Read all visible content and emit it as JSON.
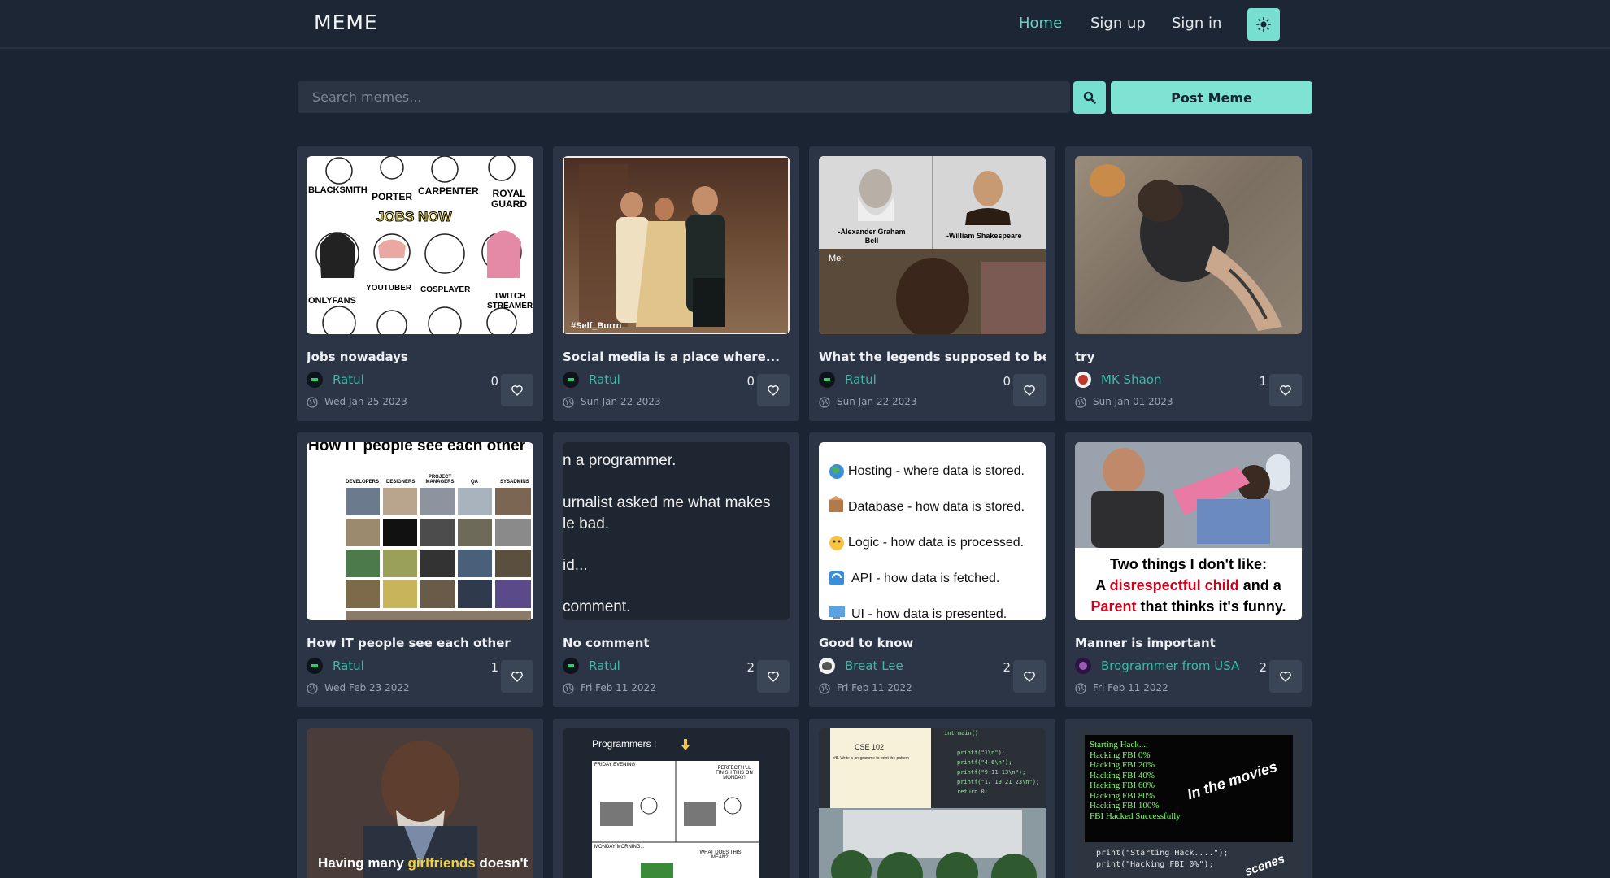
{
  "nav": {
    "brand": "MEME",
    "links": [
      "Home",
      "Sign up",
      "Sign in"
    ]
  },
  "search": {
    "placeholder": "Search memes...",
    "post_label": "Post Meme"
  },
  "colors": {
    "accent": "#76dfd0",
    "author": "#3fb8a8",
    "background": "#1b2433",
    "card": "#2b3545"
  },
  "cards": [
    {
      "title": "Jobs nowadays",
      "author": "Ratul",
      "likes": "0",
      "date": "Wed Jan 25 2023",
      "thumb_text": [
        "BLACKSMITH",
        "PORTER",
        "CARPENTER",
        "ROYAL GUARD",
        "JOBS NOW",
        "YOUTUBER",
        "COSPLAYER",
        "TWITCH STREAMER",
        "ONLYFANS"
      ]
    },
    {
      "title": "Social media is a place where...",
      "author": "Ratul",
      "likes": "0",
      "date": "Sun Jan 22 2023",
      "thumb_text": [
        "#Self_Burrn"
      ]
    },
    {
      "title": "What the legends supposed to be...",
      "author": "Ratul",
      "likes": "0",
      "date": "Sun Jan 22 2023",
      "thumb_text": [
        "-Alexander Graham Bell",
        "-William Shakespeare",
        "Me:"
      ]
    },
    {
      "title": "try",
      "author": "MK Shaon",
      "likes": "1",
      "date": "Sun Jan 01 2023",
      "thumb_text": []
    },
    {
      "title": "How IT people see each other",
      "author": "Ratul",
      "likes": "1",
      "date": "Wed Feb 23 2022",
      "thumb_text": [
        "How IT people see each other",
        "DEVELOPERS",
        "DESIGNERS",
        "PROJECT MANAGERS",
        "QA",
        "SYSADMINS"
      ]
    },
    {
      "title": "No comment",
      "author": "Ratul",
      "likes": "2",
      "date": "Fri Feb 11 2022",
      "thumb_text": [
        "n a programmer.",
        "urnalist asked me what makes",
        "le bad.",
        "id...",
        "comment."
      ]
    },
    {
      "title": "Good to know",
      "author": "Breat Lee",
      "likes": "2",
      "date": "Fri Feb 11 2022",
      "thumb_text": [
        "Hosting - where data is stored.",
        "Database - how data is stored.",
        "Logic - how data is processed.",
        "API - how data is fetched.",
        "UI - how data is presented."
      ]
    },
    {
      "title": "Manner is important",
      "author": "Brogrammer from USA",
      "likes": "2",
      "date": "Fri Feb 11 2022",
      "thumb_text": [
        "Two things I don't like:",
        "A",
        "disrespectful child",
        "and a",
        "Parent",
        "that thinks it's funny."
      ]
    },
    {
      "thumb_text": [
        "Having many",
        "girlfriends",
        "doesn't"
      ]
    },
    {
      "thumb_text": [
        "Programmers :",
        "FRIDAY EVENING",
        "PERFECT! I'LL FINISH THIS ON MONDAY!",
        "MONDAY MORNING...",
        "WHAT DOES THIS MEAN?!"
      ]
    },
    {
      "thumb_text": [
        "CSE 102",
        "#8. Write a programme to print the pattern",
        "int main()",
        "printf(\"1\\n\");",
        "printf(\"4 6\\n\");",
        "printf(\"9 11 13\\n\");",
        "printf(\"17 19 21 23\\n\");",
        "return 0;"
      ]
    },
    {
      "thumb_text": [
        "Starting Hack....",
        "Hacking FBI 0%",
        "Hacking FBI 20%",
        "Hacking FBI 40%",
        "Hacking FBI 60%",
        "Hacking FBI 80%",
        "Hacking FBI 100%",
        "FBI Hacked Successfully",
        "In the movies",
        "print(\"Starting Hack....\");",
        "print(\"Hacking FBI 0%\");",
        "scenes"
      ]
    }
  ]
}
